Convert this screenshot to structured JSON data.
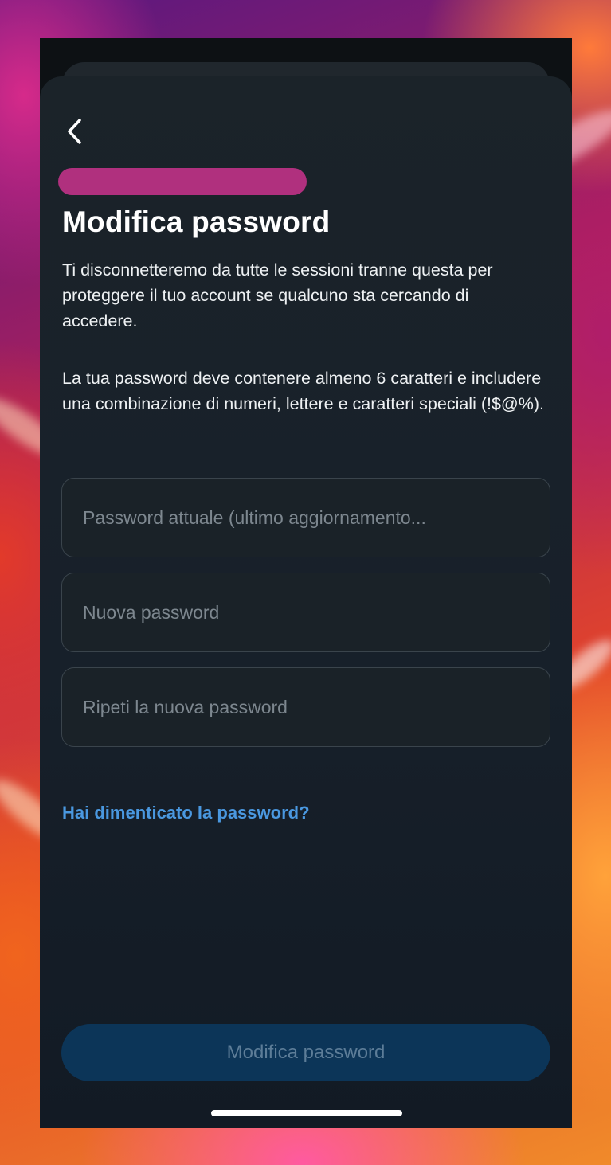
{
  "screen": {
    "title": "Modifica password",
    "description_1": "Ti disconnetteremo da tutte le sessioni tranne questa per proteggere il tuo account se qualcuno sta cercando di accedere.",
    "description_2": "La tua password deve contenere almeno 6 caratteri e includere una combinazione di numeri, lettere e caratteri speciali (!$@%)."
  },
  "fields": {
    "current_password": {
      "placeholder": "Password attuale (ultimo aggiornamento...",
      "value": ""
    },
    "new_password": {
      "placeholder": "Nuova password",
      "value": ""
    },
    "repeat_password": {
      "placeholder": "Ripeti la nuova password",
      "value": ""
    }
  },
  "links": {
    "forgot_password": "Hai dimenticato la password?"
  },
  "buttons": {
    "submit_label": "Modifica password"
  },
  "icons": {
    "back": "chevron-left-icon"
  },
  "colors": {
    "background": "#17202a",
    "account_pill": "#b0307e",
    "link": "#4a98e0",
    "button_disabled": "#0c3558",
    "button_text_disabled": "#5d7d98"
  }
}
